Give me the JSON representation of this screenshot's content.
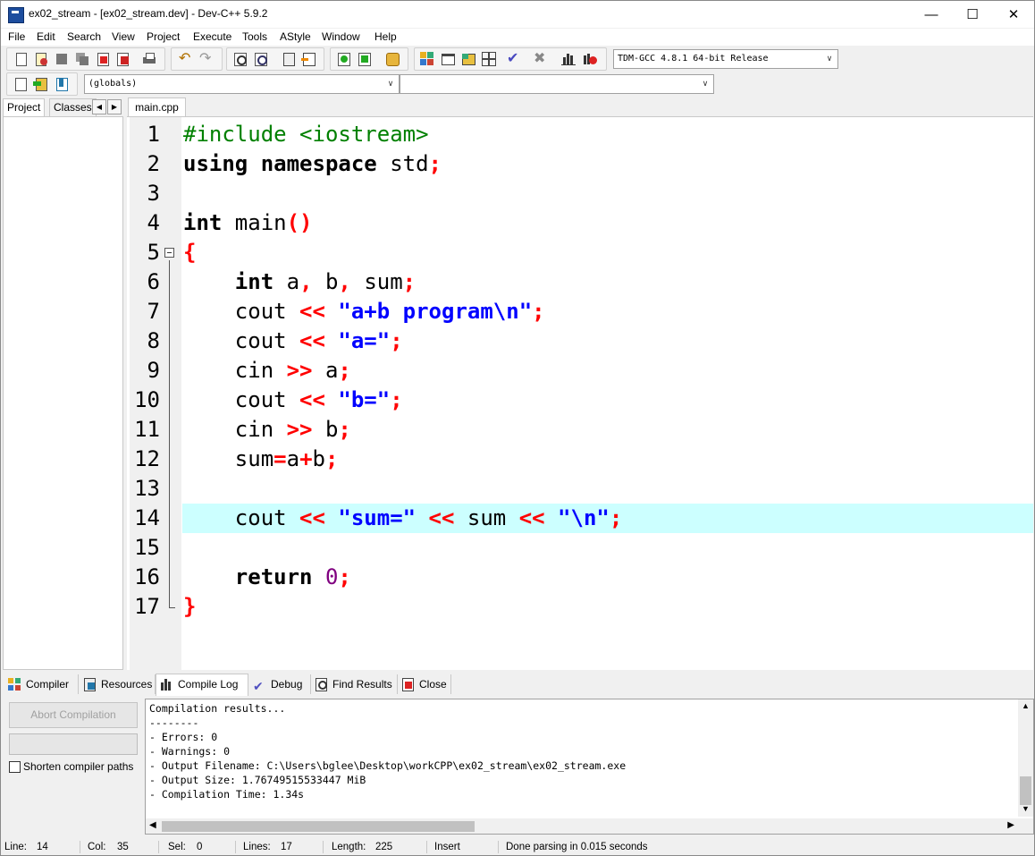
{
  "window": {
    "title": "ex02_stream - [ex02_stream.dev] - Dev-C++ 5.9.2",
    "min_glyph": "—",
    "max_glyph": "☐",
    "close_glyph": "✕"
  },
  "menu": [
    "File",
    "Edit",
    "Search",
    "View",
    "Project",
    "Execute",
    "Tools",
    "AStyle",
    "Window",
    "Help"
  ],
  "toolbar": {
    "compiler_select": "TDM-GCC 4.8.1 64-bit Release",
    "scope_select": "(globals)",
    "function_select": ""
  },
  "left_panel": {
    "tabs": [
      "Project",
      "Classes"
    ],
    "nav_left": "◀",
    "nav_right": "▶"
  },
  "editor": {
    "tab": "main.cpp",
    "active_line": 14,
    "line_numbers": [
      "1",
      "2",
      "3",
      "4",
      "5",
      "6",
      "7",
      "8",
      "9",
      "10",
      "11",
      "12",
      "13",
      "14",
      "15",
      "16",
      "17"
    ],
    "code": {
      "l1": "#include <iostream>",
      "l2_kw": "using namespace",
      "l2_id": " std",
      "l2_sym": ";",
      "l4_kw": "int",
      "l4_id": " main",
      "l4_sym": "()",
      "l5_sym": "{",
      "l6_indent": "    ",
      "l6_kw": "int",
      "l6_a": " a",
      "l6_c1": ",",
      "l6_b": " b",
      "l6_c2": ",",
      "l6_sum": " sum",
      "l6_semi": ";",
      "l7_id": "    cout ",
      "l7_op": "<<",
      "l7_str": " \"a+b program\\n\"",
      "l7_semi": ";",
      "l8_id": "    cout ",
      "l8_op": "<<",
      "l8_str": " \"a=\"",
      "l8_semi": ";",
      "l9_id": "    cin ",
      "l9_op": ">>",
      "l9_var": " a",
      "l9_semi": ";",
      "l10_id": "    cout ",
      "l10_op": "<<",
      "l10_str": " \"b=\"",
      "l10_semi": ";",
      "l11_id": "    cin ",
      "l11_op": ">>",
      "l11_var": " b",
      "l11_semi": ";",
      "l12_id1": "    sum",
      "l12_eq": "=",
      "l12_a": "a",
      "l12_plus": "+",
      "l12_b": "b",
      "l12_semi": ";",
      "l14_id": "    cout ",
      "l14_op1": "<<",
      "l14_str1": " \"sum=\" ",
      "l14_op2": "<<",
      "l14_sum": " sum ",
      "l14_op3": "<<",
      "l14_str2": " \"\\n\"",
      "l14_semi": ";",
      "l16_indent": "    ",
      "l16_kw": "return",
      "l16_num": " 0",
      "l16_semi": ";",
      "l17_sym": "}"
    }
  },
  "bottom_tabs": [
    "Compiler",
    "Resources",
    "Compile Log",
    "Debug",
    "Find Results",
    "Close"
  ],
  "bottom_active_tab": "Compile Log",
  "compile": {
    "abort_label": "Abort Compilation",
    "shorten_label": "Shorten compiler paths",
    "shorten_checked": false,
    "log_lines": [
      "Compilation results...",
      "--------",
      "- Errors: 0",
      "- Warnings: 0",
      "- Output Filename: C:\\Users\\bglee\\Desktop\\workCPP\\ex02_stream\\ex02_stream.exe",
      "- Output Size: 1.76749515533447 MiB",
      "- Compilation Time: 1.34s"
    ]
  },
  "status": {
    "line_label": "Line:",
    "line_value": "14",
    "col_label": "Col:",
    "col_value": "35",
    "sel_label": "Sel:",
    "sel_value": "0",
    "lines_label": "Lines:",
    "lines_value": "17",
    "length_label": "Length:",
    "length_value": "225",
    "mode": "Insert",
    "message": "Done parsing in 0.015 seconds"
  },
  "colors": {
    "preprocessor": "#008000",
    "symbol": "#ff0000",
    "string": "#0000ff",
    "number": "#800080",
    "active_line": "#ccffff"
  }
}
